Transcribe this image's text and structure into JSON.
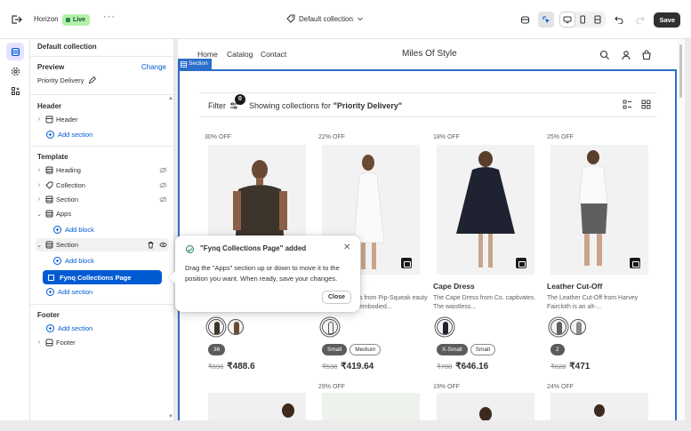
{
  "topbar": {
    "theme_name": "Horizon",
    "status": "Live",
    "template_label": "Default collection",
    "save_label": "Save"
  },
  "panel": {
    "title": "Default collection",
    "preview_label": "Preview",
    "change_label": "Change",
    "preview_value": "Priority Delivery",
    "header_group": "Header",
    "header_item": "Header",
    "add_section": "Add section",
    "template_group": "Template",
    "template_items": [
      "Heading",
      "Collection",
      "Section",
      "Apps"
    ],
    "add_block": "Add block",
    "section_label": "Section",
    "selected_app": "Fynq Collections Page",
    "footer_group": "Footer",
    "footer_item": "Footer"
  },
  "preview": {
    "nav": [
      "Home",
      "Catalog",
      "Contact"
    ],
    "store_name": "Miles Of Style",
    "section_tag": "Section",
    "filter_label": "Filter",
    "filter_count": "0",
    "showing_prefix": "Showing collections for ",
    "showing_collection": "\"Priority Delivery\"",
    "products": [
      {
        "discount": "30% OFF",
        "name": "",
        "desc": "",
        "sizes": [
          "36"
        ],
        "old_price": "₹698",
        "price": "₹488.6"
      },
      {
        "discount": "22% OFF",
        "name": "",
        "desc": "s from Pip-Squeak eauty embodied...",
        "sizes": [
          "Small",
          "Medium"
        ],
        "old_price": "₹538",
        "price": "₹419.64"
      },
      {
        "discount": "18% OFF",
        "name": "Cape Dress",
        "desc": "The Cape Dress from Co. captivates. The waistless...",
        "sizes": [
          "X-Small",
          "Small"
        ],
        "old_price": "₹788",
        "price": "₹646.16"
      },
      {
        "discount": "25% OFF",
        "name": "Leather Cut-Off",
        "desc": "The Leather Cut-Off from Harvey Faircloth is an alt-...",
        "sizes": [
          "2"
        ],
        "old_price": "₹628",
        "price": "₹471"
      }
    ],
    "row2_discounts": [
      "29% OFF",
      "19% OFF",
      "24% OFF"
    ]
  },
  "toast": {
    "title": "\"Fynq Collections Page\" added",
    "body": "Drag the \"Apps\" section up or down to move it to the position you want. When ready, save your changes.",
    "close_label": "Close"
  },
  "colors": {
    "accent": "#005bd3",
    "section_outline": "#2c6ecb",
    "live_badge": "#b4f0a8",
    "save_button": "#303030"
  }
}
